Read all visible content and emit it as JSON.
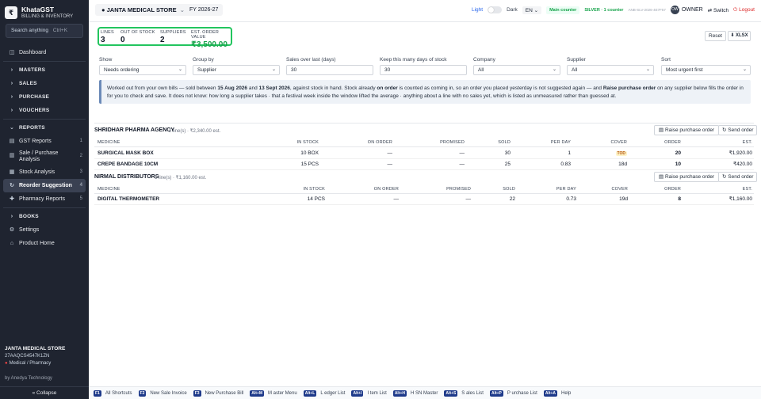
{
  "sidebar": {
    "logo_letter": "₹",
    "brand_name": "KhataGST",
    "brand_sub": "BILLING & INVENTORY",
    "search_placeholder": "Search anything",
    "search_kbd": "Ctrl+K",
    "items": [
      {
        "label": "Dashboard",
        "icon": "◫",
        "count": ""
      },
      {
        "label": "MASTERS",
        "icon": "›",
        "count": ""
      },
      {
        "label": "SALES",
        "icon": "›",
        "count": ""
      },
      {
        "label": "PURCHASE",
        "icon": "›",
        "count": ""
      },
      {
        "label": "VOUCHERS",
        "icon": "›",
        "count": ""
      },
      {
        "label": "REPORTS",
        "icon": "⌄",
        "count": ""
      },
      {
        "label": "GST Reports",
        "icon": "▤",
        "count": "1"
      },
      {
        "label": "Sale / Purchase",
        "label2": "Analysis",
        "icon": "▥",
        "count": "2"
      },
      {
        "label": "Stock Analysis",
        "icon": "▦",
        "count": "3"
      },
      {
        "label": "Reorder Suggestion",
        "icon": "↻",
        "count": "4"
      },
      {
        "label": "Pharmacy Reports",
        "icon": "✚",
        "count": "5"
      },
      {
        "label": "BOOKS",
        "icon": "›",
        "count": ""
      },
      {
        "label": "Settings",
        "icon": "⚙",
        "count": ""
      },
      {
        "label": "Product Home",
        "icon": "⌂",
        "count": ""
      }
    ],
    "footer_store": "JANTA MEDICAL STORE",
    "footer_gstin": "27AAQCS4547K1ZN",
    "footer_type": "Medical / Pharmacy",
    "footer_by": "by Anedya Technology",
    "collapse_label": "« Collapse"
  },
  "topbar": {
    "store_name": "JANTA MEDICAL STORE",
    "fy": "FY 2026-27",
    "light": "Light",
    "dark": "Dark",
    "lang": "EN",
    "counter": "Main counter",
    "plan": "SILVER · 1 counter",
    "code": "ANB-SLV-2026-4E7F57",
    "avatar_initials": "OW",
    "owner": "OWNER",
    "switch": "Switch",
    "logout": "Logout"
  },
  "summary": {
    "lines_label": "LINES",
    "lines_value": "3",
    "oos_label": "OUT OF STOCK",
    "oos_value": "0",
    "suppliers_label": "SUPPLIERS",
    "suppliers_value": "2",
    "est_label": "EST. ORDER VALUE",
    "est_value": "₹3,500.00"
  },
  "actions": {
    "reset": "Reset",
    "xlsx": "⬇ XLSX"
  },
  "filters": [
    {
      "label": "Show",
      "value": "Needs ordering",
      "select": true
    },
    {
      "label": "Group by",
      "value": "Supplier",
      "select": true
    },
    {
      "label": "Sales over last (days)",
      "value": "30",
      "select": false
    },
    {
      "label": "Keep this many days of stock",
      "value": "30",
      "select": false
    },
    {
      "label": "Company",
      "value": "All",
      "select": true
    },
    {
      "label": "Supplier",
      "value": "All",
      "select": true
    },
    {
      "label": "Sort",
      "value": "Most urgent first",
      "select": true
    }
  ],
  "info": {
    "t1": "Worked out from your own bills — sold between ",
    "d1": "15 Aug 2026",
    "t2": " and ",
    "d2": "13 Sept 2026",
    "t3": ", against stock in hand. Stock already ",
    "b1": "on order",
    "t4": " is counted as coming in, so an order you placed yesterday is not suggested again — and ",
    "b2": "Raise purchase order",
    "t5": " on any supplier below fills the order in for you to check and save. It does not know: how long a supplier takes · that a festival week inside the window lifted the average · anything about a line with no sales yet, which is listed as unmeasured rather than guessed at."
  },
  "columns": {
    "medicine": "MEDICINE",
    "in_stock": "IN STOCK",
    "on_order": "ON ORDER",
    "promised": "PROMISED",
    "sold": "SOLD",
    "per_day": "PER DAY",
    "cover": "COVER",
    "order": "ORDER",
    "est": "EST."
  },
  "buttons": {
    "raise_po": "Raise purchase order",
    "send_order": "Send order"
  },
  "groups": [
    {
      "supplier": "SHRIDHAR PHARMA AGENCY",
      "meta": "2 line(s) · ₹2,340.00 est.",
      "rows": [
        {
          "medicine": "SURGICAL MASK BOX",
          "in_stock": "10 BOX",
          "on_order": "—",
          "promised": "—",
          "sold": "30",
          "per_day": "1",
          "cover": "TOD",
          "order": "20",
          "est": "₹1,920.00"
        },
        {
          "medicine": "CREPE BANDAGE 10CM",
          "in_stock": "15 PCS",
          "on_order": "—",
          "promised": "—",
          "sold": "25",
          "per_day": "0.83",
          "cover": "18d",
          "order": "10",
          "est": "₹420.00"
        }
      ]
    },
    {
      "supplier": "NIRMAL DISTRIBUTORS",
      "meta": "1 line(s) · ₹1,160.00 est.",
      "rows": [
        {
          "medicine": "DIGITAL THERMOMETER",
          "in_stock": "14 PCS",
          "on_order": "—",
          "promised": "—",
          "sold": "22",
          "per_day": "0.73",
          "cover": "19d",
          "order": "8",
          "est": "₹1,160.00"
        }
      ]
    }
  ],
  "shortcuts": [
    {
      "key": "F1",
      "label": "All Shortcuts"
    },
    {
      "key": "F2",
      "label": "New Sale Invoice"
    },
    {
      "key": "F3",
      "label": "New Purchase Bill"
    },
    {
      "key": "Alt+M",
      "label": "M aster Menu"
    },
    {
      "key": "Alt+L",
      "label": "L edger List"
    },
    {
      "key": "Alt+I",
      "label": "I tem List"
    },
    {
      "key": "Alt+H",
      "label": "H SN Master"
    },
    {
      "key": "Alt+S",
      "label": "S ales List"
    },
    {
      "key": "Alt+P",
      "label": "P urchase List"
    },
    {
      "key": "Alt+A",
      "label": "Help"
    }
  ]
}
